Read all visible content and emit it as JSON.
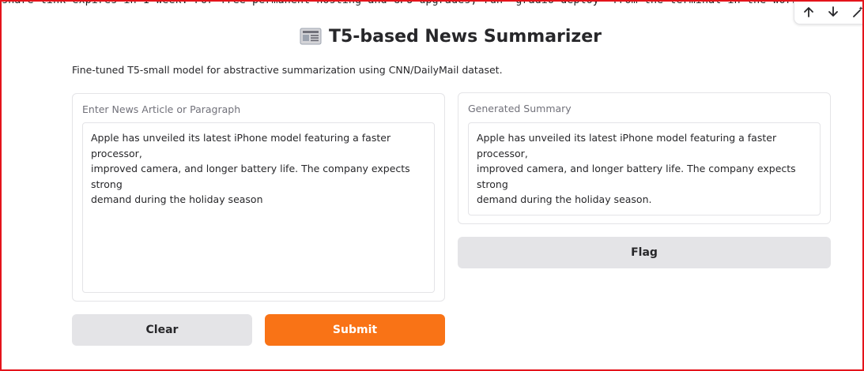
{
  "share_message": "share link expires in 1 week. For free permanent hosting and GPU upgrades, run `gradio deploy` from the terminal in the working dir",
  "toolbar": {
    "icons": [
      "arrow-up-icon",
      "arrow-down-icon",
      "magic-wand-icon"
    ]
  },
  "header": {
    "title": "T5-based News Summarizer",
    "icon": "newspaper-icon"
  },
  "description": "Fine-tuned T5-small model for abstractive summarization using CNN/DailyMail dataset.",
  "input_panel": {
    "label": "Enter News Article or Paragraph",
    "value": "Apple has unveiled its latest iPhone model featuring a faster processor,\nimproved camera, and longer battery life. The company expects strong\ndemand during the holiday season"
  },
  "output_panel": {
    "label": "Generated Summary",
    "value": "Apple has unveiled its latest iPhone model featuring a faster processor,\nimproved camera, and longer battery life. The company expects strong\ndemand during the holiday season."
  },
  "buttons": {
    "clear": "Clear",
    "submit": "Submit",
    "flag": "Flag"
  },
  "colors": {
    "primary": "#f97316",
    "secondary": "#e4e4e7",
    "frame": "#e4141b"
  }
}
